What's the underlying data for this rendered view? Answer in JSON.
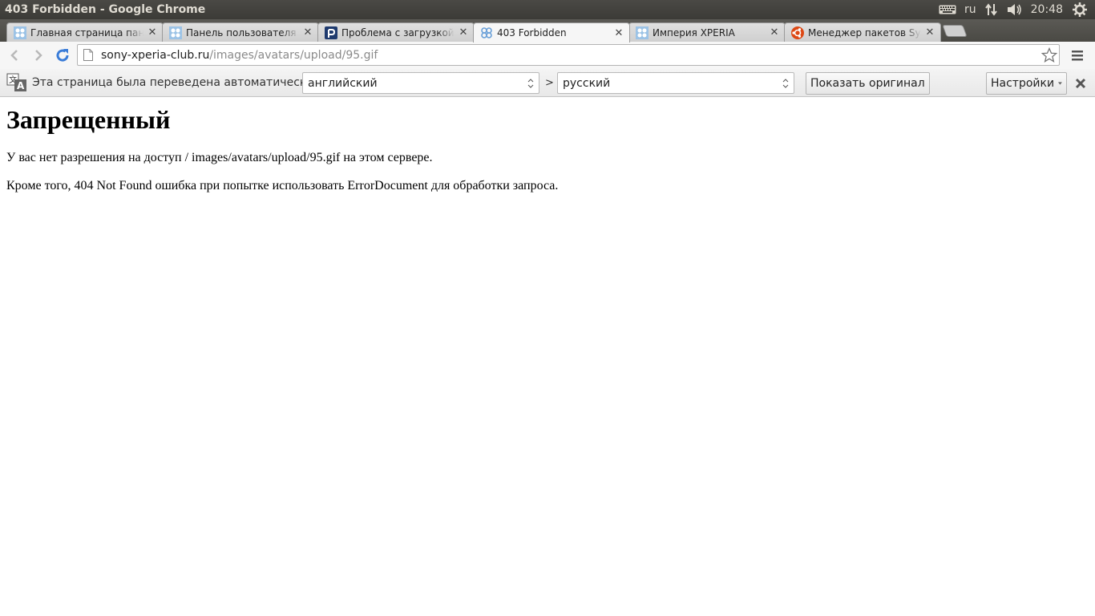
{
  "os": {
    "window_title": "403 Forbidden - Google Chrome",
    "keyboard_layout": "ru",
    "time": "20:48",
    "icons": [
      "keyboard-icon",
      "network-icon",
      "volume-icon",
      "gear-icon"
    ]
  },
  "tabs": [
    {
      "label": "Главная страница панели",
      "favicon": "xperia-favicon",
      "active": false
    },
    {
      "label": "Панель пользователя - А",
      "favicon": "xperia-favicon",
      "active": false
    },
    {
      "label": "Проблема с загрузкой ав",
      "favicon": "p-favicon",
      "active": false
    },
    {
      "label": "403 Forbidden",
      "favicon": "xperia-favicon",
      "active": true
    },
    {
      "label": "Империя XPERIA",
      "favicon": "xperia-favicon",
      "active": false
    },
    {
      "label": "Менеджер пакетов Synap",
      "favicon": "ubuntu-favicon",
      "active": false
    }
  ],
  "toolbar": {
    "url_host": "sony-xperia-club.ru",
    "url_path": "/images/avatars/upload/95.gif"
  },
  "translate": {
    "message": "Эта страница была переведена автоматически",
    "from_language": "английский",
    "separator": ">",
    "to_language": "русский",
    "show_original_label": "Показать оригинал",
    "settings_label": "Настройки"
  },
  "page": {
    "heading": "Запрещенный",
    "paragraph1": "У вас нет разрешения на доступ / images/avatars/upload/95.gif на этом сервере.",
    "paragraph2": "Кроме того, 404 Not Found ошибка при попытке использовать ErrorDocument для обработки запроса."
  },
  "colors": {
    "os_panel": "#3c3b37",
    "tab_strip": "#4a4944",
    "reload_blue": "#3b7dd8",
    "ubuntu_orange": "#dd4814"
  }
}
